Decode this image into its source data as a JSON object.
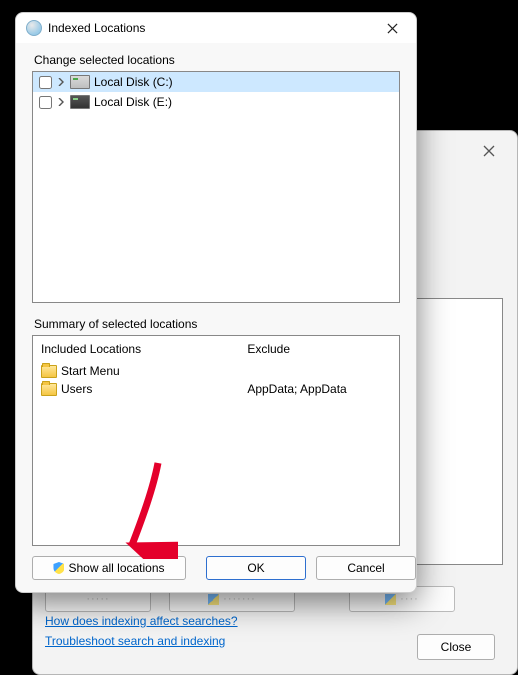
{
  "dialog": {
    "title": "Indexed Locations",
    "change_label": "Change selected locations",
    "tree": [
      {
        "label": "Local Disk (C:)",
        "selected": true,
        "icon": "light"
      },
      {
        "label": "Local Disk (E:)",
        "selected": false,
        "icon": "dark"
      }
    ],
    "summary_label": "Summary of selected locations",
    "included_header": "Included Locations",
    "exclude_header": "Exclude",
    "included": [
      {
        "label": "Start Menu",
        "exclude": ""
      },
      {
        "label": "Users",
        "exclude": "AppData; AppData"
      }
    ],
    "show_all": "Show all locations",
    "ok": "OK",
    "cancel": "Cancel"
  },
  "parent": {
    "links": {
      "affect": "How does indexing affect searches?",
      "troubleshoot": "Troubleshoot search and indexing"
    },
    "close": "Close"
  }
}
